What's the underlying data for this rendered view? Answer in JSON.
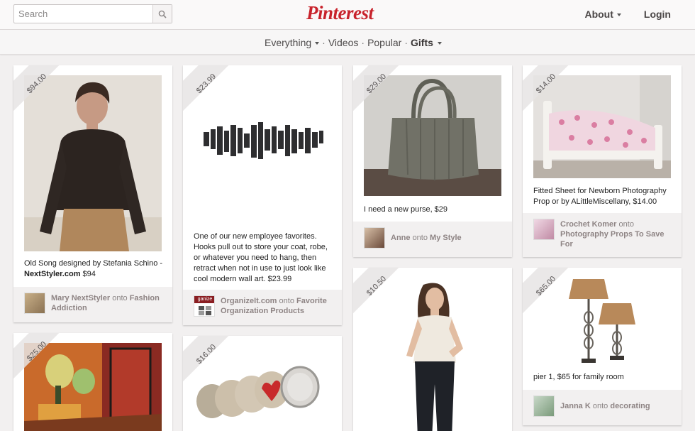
{
  "search": {
    "placeholder": "Search"
  },
  "logo": "Pinterest",
  "topnav": {
    "about": "About",
    "login": "Login"
  },
  "subnav": [
    {
      "label": "Everything",
      "dropdown": true
    },
    {
      "label": "Videos"
    },
    {
      "label": "Popular"
    },
    {
      "label": "Gifts",
      "dropdown": true,
      "active": true
    }
  ],
  "pins": {
    "p1": {
      "price": "$94.00",
      "desc_a": "Old Song designed by Stefania Schino - ",
      "desc_link": "NextStyler.com",
      "desc_b": " $94",
      "user": "Mary NextStyler",
      "onto": "onto",
      "board": "Fashion Addiction"
    },
    "p2": {
      "price": "$25.00"
    },
    "p3": {
      "price": "$23.99",
      "desc": "One of our new employee favorites. Hooks pull out to store your coat, robe, or whatever you need to hang, then retract when not in use to just look like cool modern wall art. $23.99",
      "user": "OrganizeIt.com",
      "onto": "onto",
      "board": "Favorite Organization Products",
      "avatar_text": "ganize"
    },
    "p4": {
      "price": "$16.00"
    },
    "p5": {
      "price": "$29.00",
      "desc": "I need a new purse, $29",
      "user": "Anne",
      "onto": "onto",
      "board": "My Style"
    },
    "p6": {
      "price": "$10.50"
    },
    "p7": {
      "price": "$14.00",
      "desc": "Fitted Sheet for Newborn Photography Prop or by ALittleMiscellany, $14.00",
      "user": "Crochet Komer",
      "onto": "onto",
      "board": "Photography Props To Save For"
    },
    "p8": {
      "price": "$65.00",
      "desc": "pier 1, $65 for family room",
      "user": "Janna K",
      "onto": "onto",
      "board": "decorating"
    }
  },
  "colors": {
    "brand": "#c8232c",
    "background": "#f2f0f0"
  }
}
